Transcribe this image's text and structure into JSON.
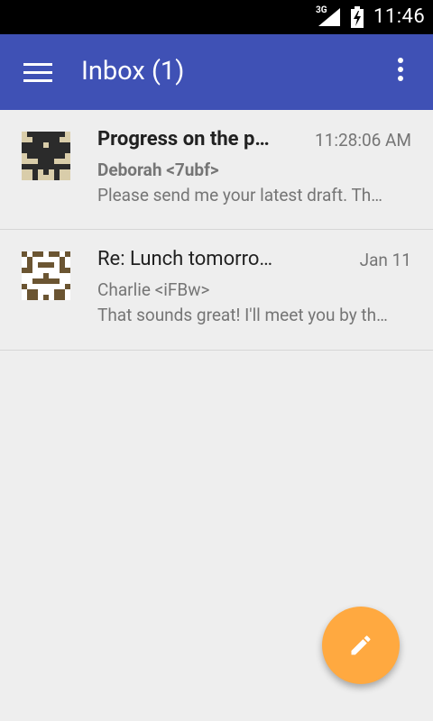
{
  "status_bar": {
    "network": "3G",
    "time": "11:46"
  },
  "app_bar": {
    "title": "Inbox (1)"
  },
  "emails": [
    {
      "subject": "Progress on the project",
      "sender": "Deborah <7ubf>",
      "time": "11:28:06 AM",
      "preview": "Please send me your latest draft. Thanks!",
      "unread": true
    },
    {
      "subject": "Re: Lunch tomorrow?",
      "sender": "Charlie <iFBw>",
      "time": "Jan 11",
      "preview": "That sounds great! I'll meet you by the entrance.",
      "unread": false
    }
  ],
  "colors": {
    "primary": "#3f51b5",
    "fab": "#ffa940",
    "background": "#eeeeee"
  },
  "icons": {
    "menu": "hamburger-menu-icon",
    "more": "more-vert-icon",
    "compose": "pencil-icon",
    "signal": "signal-icon",
    "battery": "battery-charging-icon"
  }
}
